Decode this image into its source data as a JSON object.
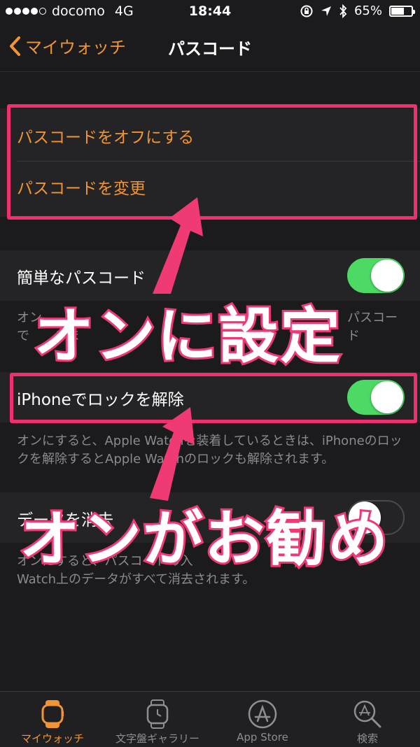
{
  "status_bar": {
    "carrier": "docomo",
    "network": "4G",
    "time": "18:44",
    "battery_percent": "65%",
    "battery_level": 0.65
  },
  "nav": {
    "back_label": "マイウォッチ",
    "title": "パスコード"
  },
  "passcode_group": {
    "turn_off_label": "パスコードをオフにする",
    "change_label": "パスコードを変更"
  },
  "simple_passcode": {
    "label": "簡単なパスコード",
    "on": true,
    "footnote_line1": "オン",
    "footnote_line1_right": "パスコード",
    "footnote_line2": "で　　きま"
  },
  "unlock_with_iphone": {
    "label": "iPhoneでロックを解除",
    "on": true,
    "footnote": "オンにすると、Apple Watchを装着しているときは、iPhoneのロックを解除するとApple Watchのロックも解除されます。"
  },
  "erase_data": {
    "label": "データを消去",
    "on": false,
    "footnote_line1": "オンにすると、パスコードの入",
    "footnote_line2": "Watch上のデータがすべて消去されます。"
  },
  "annotations": {
    "callout_1": "オンに設定",
    "callout_2": "オンがお勧め",
    "highlight_color": "#f0306e"
  },
  "tab_bar": {
    "tabs": [
      {
        "label": "マイウォッチ",
        "icon": "watch-icon",
        "active": true
      },
      {
        "label": "文字盤ギャラリー",
        "icon": "watch-face-icon",
        "active": false
      },
      {
        "label": "App Store",
        "icon": "app-store-icon",
        "active": false
      },
      {
        "label": "検索",
        "icon": "search-icon",
        "active": false
      }
    ]
  },
  "colors": {
    "accent": "#f29433",
    "toggle_on": "#4cd964",
    "background": "#1b1b1d"
  }
}
